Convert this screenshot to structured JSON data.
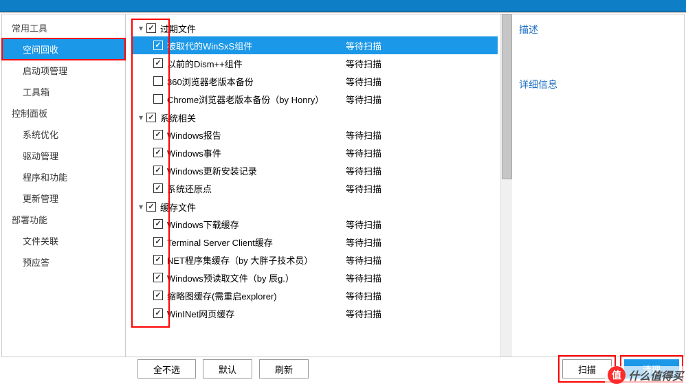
{
  "sidebar": {
    "sections": [
      {
        "header": "常用工具",
        "items": [
          {
            "label": "空间回收",
            "selected": true
          },
          {
            "label": "启动项管理",
            "selected": false
          },
          {
            "label": "工具箱",
            "selected": false
          }
        ]
      },
      {
        "header": "控制面板",
        "items": [
          {
            "label": "系统优化",
            "selected": false
          },
          {
            "label": "驱动管理",
            "selected": false
          },
          {
            "label": "程序和功能",
            "selected": false
          },
          {
            "label": "更新管理",
            "selected": false
          }
        ]
      },
      {
        "header": "部署功能",
        "items": [
          {
            "label": "文件关联",
            "selected": false
          },
          {
            "label": "预应答",
            "selected": false
          }
        ]
      }
    ]
  },
  "groups": [
    {
      "name": "过期文件",
      "expanded": true,
      "checked": true,
      "children": [
        {
          "label": "被取代的WinSxS组件",
          "checked": true,
          "status": "等待扫描",
          "selected": true
        },
        {
          "label": "以前的Dism++组件",
          "checked": true,
          "status": "等待扫描",
          "selected": false
        },
        {
          "label": "360浏览器老版本备份",
          "checked": false,
          "status": "等待扫描",
          "selected": false
        },
        {
          "label": "Chrome浏览器老版本备份（by Honry）",
          "checked": false,
          "status": "等待扫描",
          "selected": false
        }
      ]
    },
    {
      "name": "系统相关",
      "expanded": true,
      "checked": true,
      "children": [
        {
          "label": "Windows报告",
          "checked": true,
          "status": "等待扫描",
          "selected": false
        },
        {
          "label": "Windows事件",
          "checked": true,
          "status": "等待扫描",
          "selected": false
        },
        {
          "label": "Windows更新安装记录",
          "checked": true,
          "status": "等待扫描",
          "selected": false
        },
        {
          "label": "系统还原点",
          "checked": true,
          "status": "等待扫描",
          "selected": false
        }
      ]
    },
    {
      "name": "缓存文件",
      "expanded": true,
      "checked": true,
      "children": [
        {
          "label": "Windows下载缓存",
          "checked": true,
          "status": "等待扫描",
          "selected": false
        },
        {
          "label": "Terminal Server Client缓存",
          "checked": true,
          "status": "等待扫描",
          "selected": false
        },
        {
          "label": "NET程序集缓存（by 大胖子技术员）",
          "checked": true,
          "status": "等待扫描",
          "selected": false
        },
        {
          "label": "Windows预读取文件（by 辰g.）",
          "checked": true,
          "status": "等待扫描",
          "selected": false
        },
        {
          "label": "缩略图缓存(需重启explorer)",
          "checked": true,
          "status": "等待扫描",
          "selected": false
        },
        {
          "label": "WinINet网页缓存",
          "checked": true,
          "status": "等待扫描",
          "selected": false
        }
      ]
    }
  ],
  "rightpanel": {
    "desc_label": "描述",
    "detail_label": "详细信息"
  },
  "buttons": {
    "deselect_all": "全不选",
    "default": "默认",
    "refresh": "刷新",
    "scan": "扫描",
    "clean": "清理"
  },
  "watermark": {
    "logo": "值",
    "text": "什么值得买"
  }
}
